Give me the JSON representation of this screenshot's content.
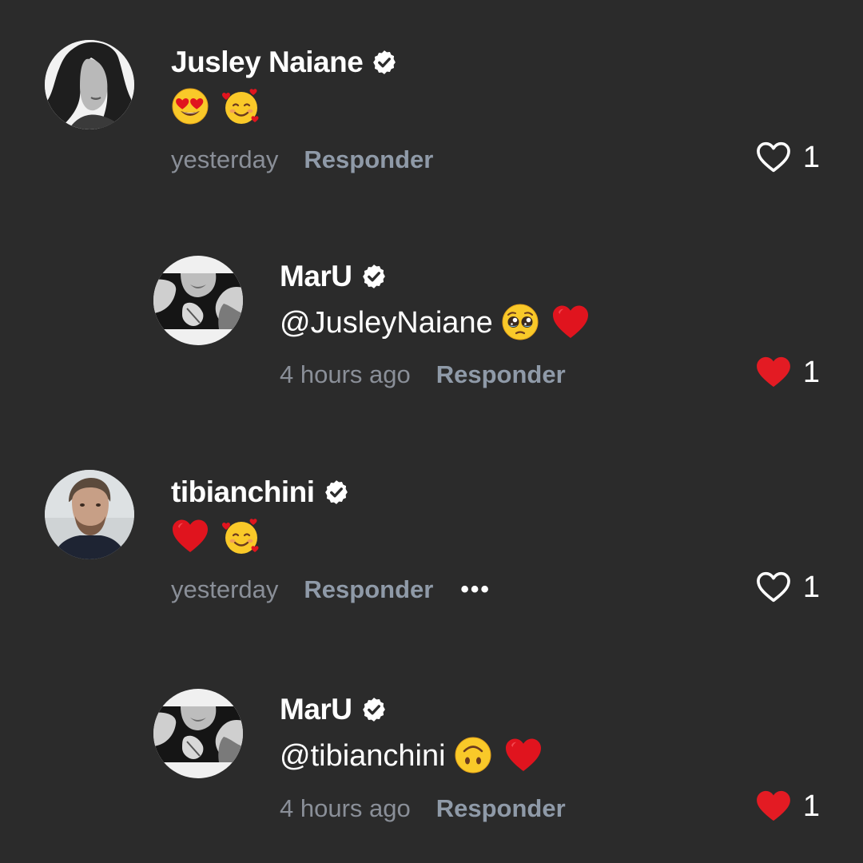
{
  "colors": {
    "background": "#2b2b2b",
    "text": "#ffffff",
    "muted": "#8a8f98",
    "reply": "#8f9aa8",
    "liked_heart": "#e31b23"
  },
  "comments": [
    {
      "author": "Jusley Naiane",
      "verified": true,
      "text": "",
      "emojis": [
        "heart-eyes-emoji",
        "smiling-face-with-hearts-emoji"
      ],
      "time": "yesterday",
      "reply_label": "Responder",
      "liked": false,
      "likes": "1",
      "is_reply": false
    },
    {
      "author": "MarU",
      "verified": true,
      "text": "@JusleyNaiane",
      "emojis": [
        "pleading-face-emoji",
        "red-heart-emoji"
      ],
      "time": "4 hours ago",
      "reply_label": "Responder",
      "liked": true,
      "likes": "1",
      "is_reply": true
    },
    {
      "author": "tibianchini",
      "verified": true,
      "text": "",
      "emojis": [
        "red-heart-emoji",
        "smiling-face-with-hearts-emoji"
      ],
      "time": "yesterday",
      "reply_label": "Responder",
      "more_label": "•••",
      "liked": false,
      "likes": "1",
      "is_reply": false
    },
    {
      "author": "MarU",
      "verified": true,
      "text": "@tibianchini",
      "emojis": [
        "upside-down-face-emoji",
        "red-heart-emoji"
      ],
      "time": "4 hours ago",
      "reply_label": "Responder",
      "liked": true,
      "likes": "1",
      "is_reply": true
    }
  ]
}
